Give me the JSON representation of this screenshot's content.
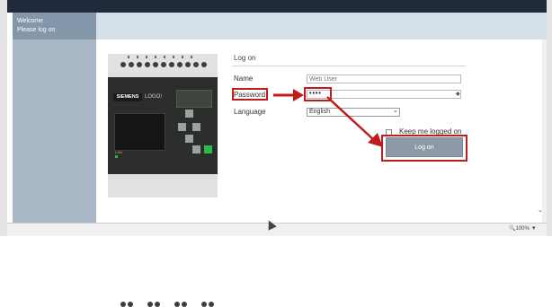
{
  "sidebar": {
    "welcome": "Welcome",
    "prompt": "Please log on"
  },
  "device": {
    "brand": "SIEMENS",
    "model": "LOGO!",
    "led_label": "LAN"
  },
  "form": {
    "title": "Log on",
    "name_label": "Name",
    "name_placeholder": "Web User",
    "password_label": "Password",
    "password_value": "••••",
    "language_label": "Language",
    "language_value": "English",
    "keep_logged_label": "Keep me logged on",
    "logon_button": "Log on"
  },
  "statusbar": {
    "zoom": "100%"
  },
  "colors": {
    "highlight": "#c01c1c",
    "topbar": "#1f2b3a",
    "sidebar": "#a9b7c6",
    "button": "#8c9aa8"
  }
}
